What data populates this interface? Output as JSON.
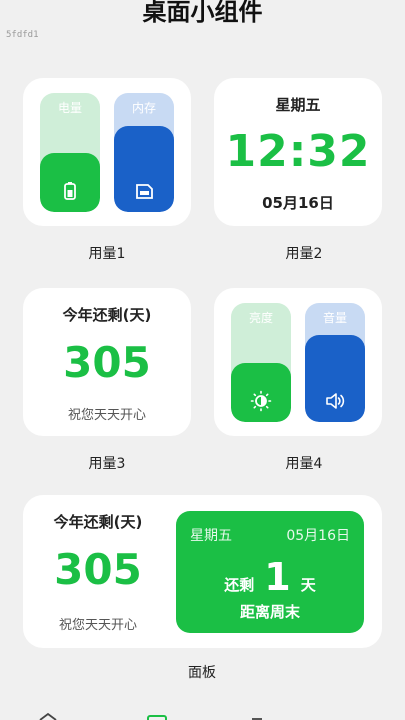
{
  "header": {
    "title": "桌面小组件",
    "debug_label": "5fdfd1"
  },
  "widget1": {
    "caption": "用量1",
    "battery": {
      "label": "电量",
      "level": 0.5,
      "icon": "battery-icon"
    },
    "memory": {
      "label": "内存",
      "level": 0.72,
      "icon": "sd-card-icon"
    }
  },
  "widget2": {
    "caption": "用量2",
    "weekday": "星期五",
    "time": "12:32",
    "date": "05月16日"
  },
  "widget3": {
    "caption": "用量3",
    "title": "今年还剩(天)",
    "days": "305",
    "wish": "祝您天天开心"
  },
  "widget4": {
    "caption": "用量4",
    "brightness": {
      "label": "亮度",
      "level": 0.5,
      "icon": "brightness-icon"
    },
    "volume": {
      "label": "音量",
      "level": 0.73,
      "icon": "volume-icon"
    }
  },
  "panel": {
    "caption": "面板",
    "title": "今年还剩(天)",
    "days": "305",
    "wish": "祝您天天开心",
    "weekend": {
      "weekday": "星期五",
      "date": "05月16日",
      "remain": "还剩",
      "num": "1",
      "unit": "天",
      "until": "距离周末"
    }
  },
  "colors": {
    "accent_green": "#1bbf45",
    "accent_blue": "#1a61c8",
    "background": "#f0f0f0"
  }
}
